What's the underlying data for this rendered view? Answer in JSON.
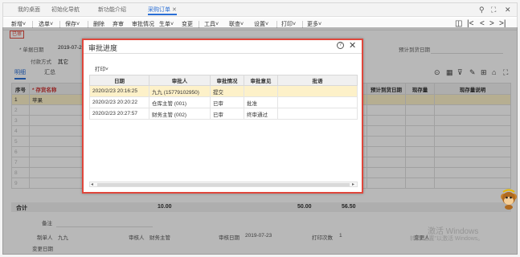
{
  "tabs": [
    {
      "label": "我的桌面"
    },
    {
      "label": "初始化导航"
    },
    {
      "label": "新功能介绍"
    },
    {
      "label": "采购订单"
    }
  ],
  "tab_close": "✕",
  "window_controls": {
    "search": "⚲",
    "restore": "⛶",
    "close": "✕"
  },
  "toolbar": {
    "add": "新增˅",
    "select": "选单˅",
    "save": "保存˅",
    "delete": "删除",
    "copy": "弃审",
    "approval": "审批情况",
    "generate": "生单˅",
    "change": "变更",
    "tools": "工具˅",
    "link": "联查˅",
    "settings": "设置˅",
    "print": "打印˅",
    "more": "更多˅"
  },
  "nav": {
    "first": "|<",
    "prev": "<",
    "next": ">",
    "last": ">|",
    "doc": "◫"
  },
  "stamp": "已审",
  "form": {
    "order_date_label": "* 单据日期",
    "order_date_value": "2019-07-2",
    "pay_method_label": "付款方式",
    "pay_method_value": "其它",
    "arrival_label": "预计到货日期"
  },
  "subtabs": {
    "detail": "明细",
    "summary": "汇总"
  },
  "grid": {
    "headers": {
      "seq": "序号",
      "item": "* 存货名称",
      "arrival": "预计到货日期",
      "stock": "现存量",
      "stock_desc": "现存量说明"
    },
    "rows": [
      {
        "seq": "1",
        "item": "苹果"
      },
      {
        "seq": "2",
        "item": ""
      },
      {
        "seq": "3",
        "item": ""
      },
      {
        "seq": "4",
        "item": ""
      },
      {
        "seq": "5",
        "item": ""
      },
      {
        "seq": "6",
        "item": ""
      },
      {
        "seq": "7",
        "item": ""
      },
      {
        "seq": "8",
        "item": ""
      },
      {
        "seq": "9",
        "item": ""
      }
    ],
    "total_label": "合计",
    "total_qty": "10.00",
    "total_price": "50.00",
    "total_amount": "56.50"
  },
  "footer": {
    "remark": "备注",
    "creator_label": "制单人",
    "creator_value": "九九",
    "auditor_label": "审核人",
    "auditor_value": "财务主管",
    "audit_date_label": "审核日期",
    "audit_date_value": "2019-07-23",
    "print_count_label": "打印次数",
    "print_count_value": "1",
    "changer_label": "变更人",
    "change_date_label": "变更日期"
  },
  "dialog": {
    "title": "审批进度",
    "print": "打印˅",
    "headers": [
      "日期",
      "审批人",
      "审批情况",
      "审批意见",
      "批语"
    ],
    "rows": [
      [
        "2020/2/23 20:16:25",
        "九九  (15779102950)",
        "提交",
        "",
        ""
      ],
      [
        "2020/2/23 20:20:22",
        "仓库主管  (001)",
        "已审",
        "批准",
        ""
      ],
      [
        "2020/2/23 20:27:57",
        "财务主管  (002)",
        "已审",
        "终审通过",
        ""
      ]
    ]
  },
  "watermark": {
    "line1": "激活 Windows",
    "line2": "转到\"设置\"以激活 Windows。"
  },
  "colors": {
    "accent": "#2a6fd6",
    "stamp": "#e34b3f",
    "highlight": "#fdf1c9"
  }
}
